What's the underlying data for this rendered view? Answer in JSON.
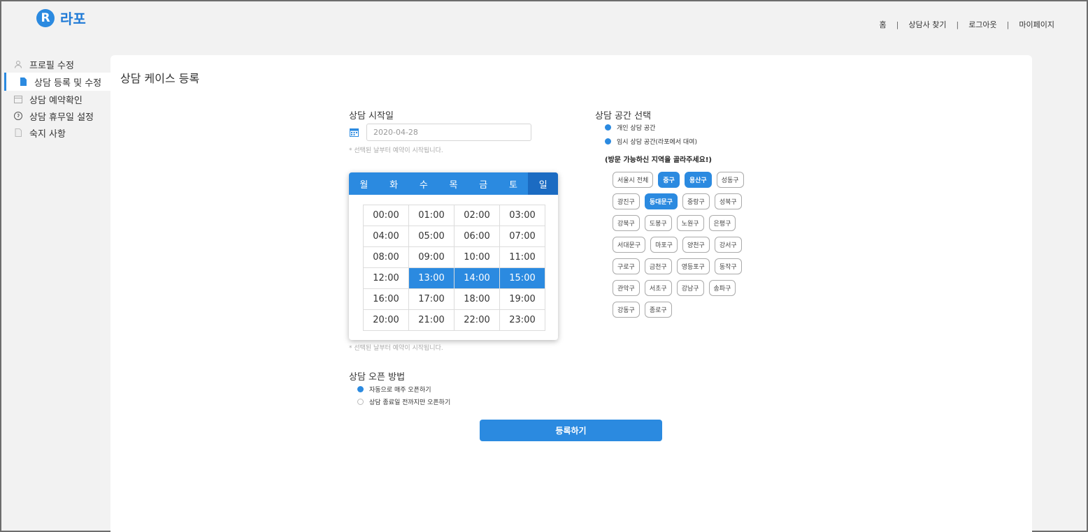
{
  "brand": {
    "name": "라포",
    "mark": "R"
  },
  "topnav": [
    "홈",
    "상담사 찾기",
    "로그아웃",
    "마이페이지"
  ],
  "sidebar": [
    {
      "label": "프로필 수정",
      "icon": "person-icon"
    },
    {
      "label": "상담 등록 및 수정",
      "icon": "document-icon",
      "active": true
    },
    {
      "label": "상담 예약확인",
      "icon": "calendar-icon"
    },
    {
      "label": "상담 휴무일 설정",
      "icon": "circle-icon"
    },
    {
      "label": "숙지 사항",
      "icon": "page-icon"
    }
  ],
  "page": {
    "title": "상담 케이스 등록",
    "start_date": {
      "label": "상담 시작일",
      "value": "2020-04-28",
      "hint": "* 선택된 날부터 예약이 시작됩니다."
    },
    "picker": {
      "days": [
        "월",
        "화",
        "수",
        "목",
        "금",
        "토",
        "일"
      ],
      "selected_day": "일",
      "times": [
        "00:00",
        "01:00",
        "02:00",
        "03:00",
        "04:00",
        "05:00",
        "06:00",
        "07:00",
        "08:00",
        "09:00",
        "10:00",
        "11:00",
        "12:00",
        "13:00",
        "14:00",
        "15:00",
        "16:00",
        "17:00",
        "18:00",
        "19:00",
        "20:00",
        "21:00",
        "22:00",
        "23:00"
      ],
      "selected_times": [
        "13:00",
        "14:00",
        "15:00"
      ],
      "hint_below": "* 선택된 날부터 예약이 시작됩니다."
    },
    "open_method": {
      "label": "상담 오픈 방법",
      "options": [
        {
          "label": "자동으로 매주 오픈하기",
          "selected": true
        },
        {
          "label": "상담 종료일 전까지만 오픈하기",
          "selected": false
        }
      ]
    },
    "space": {
      "label": "상담 공간 선택",
      "options": [
        {
          "label": "개인 상담 공간",
          "selected": true
        },
        {
          "label": "임시 상담 공간(라포에서 대여)",
          "selected": true
        }
      ],
      "region_note": "(방문 가능하신 지역을 골라주세요!)",
      "districts": [
        [
          "서울시 전체",
          "중구",
          "용산구",
          "성동구"
        ],
        [
          "광진구",
          "동대문구",
          "중랑구",
          "성북구"
        ],
        [
          "강북구",
          "도봉구",
          "노원구",
          "은평구"
        ],
        [
          "서대문구",
          "마포구",
          "양천구",
          "강서구"
        ],
        [
          "구로구",
          "금천구",
          "영등포구",
          "동작구"
        ],
        [
          "관악구",
          "서초구",
          "강남구",
          "송파구"
        ],
        [
          "강동구",
          "종로구"
        ]
      ],
      "selected_districts": [
        "중구",
        "용산구",
        "동대문구"
      ]
    },
    "submit_label": "등록하기"
  },
  "colors": {
    "accent": "#2b8ae0",
    "background": "#f2f2f2"
  }
}
